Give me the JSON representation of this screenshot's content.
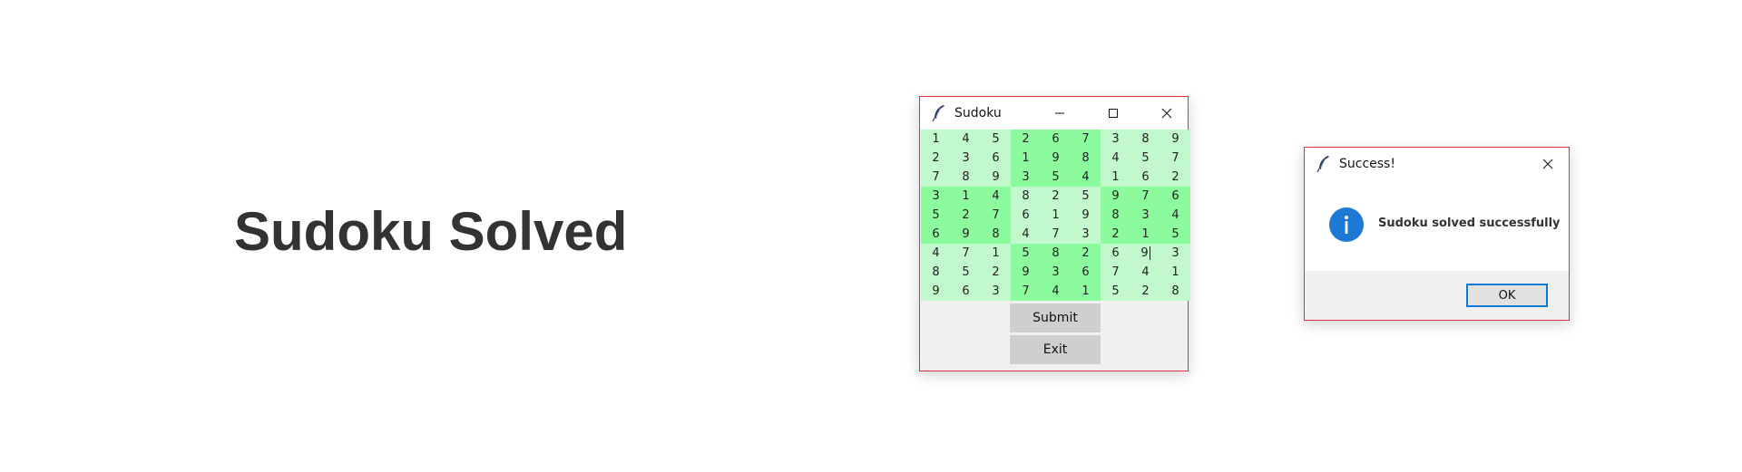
{
  "page": {
    "heading": "Sudoku Solved"
  },
  "sudoku_window": {
    "title": "Sudoku",
    "grid": [
      [
        1,
        4,
        5,
        2,
        6,
        7,
        3,
        8,
        9
      ],
      [
        2,
        3,
        6,
        1,
        9,
        8,
        4,
        5,
        7
      ],
      [
        7,
        8,
        9,
        3,
        5,
        4,
        1,
        6,
        2
      ],
      [
        3,
        1,
        4,
        8,
        2,
        5,
        9,
        7,
        6
      ],
      [
        5,
        2,
        7,
        6,
        1,
        9,
        8,
        3,
        4
      ],
      [
        6,
        9,
        8,
        4,
        7,
        3,
        2,
        1,
        5
      ],
      [
        4,
        7,
        1,
        5,
        8,
        2,
        6,
        9,
        3
      ],
      [
        8,
        5,
        2,
        9,
        3,
        6,
        7,
        4,
        1
      ],
      [
        9,
        6,
        3,
        7,
        4,
        1,
        5,
        2,
        8
      ]
    ],
    "colors": {
      "light_block": "#c2f9cc",
      "dark_block": "#8cfb9e"
    },
    "buttons": {
      "submit": "Submit",
      "exit": "Exit"
    }
  },
  "success_dialog": {
    "title": "Success!",
    "message": "Sudoku solved successfully",
    "icon": "info-icon",
    "ok_label": "OK"
  }
}
